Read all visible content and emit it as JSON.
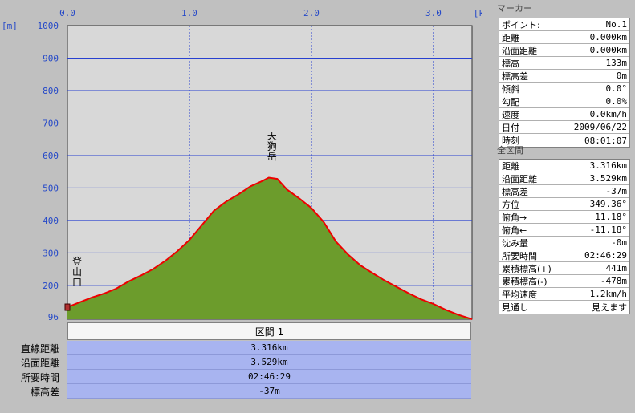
{
  "chart_data": {
    "type": "area",
    "x_unit": "[km]",
    "y_unit": "[m]",
    "xlim": [
      0,
      3.316
    ],
    "ylim": [
      96,
      1000
    ],
    "x_ticks": [
      "0.0",
      "1.0",
      "2.0",
      "3.0"
    ],
    "y_ticks": [
      "1000",
      "900",
      "800",
      "700",
      "600",
      "500",
      "400",
      "300",
      "200",
      "96"
    ],
    "x": [
      0.0,
      0.1,
      0.2,
      0.3,
      0.4,
      0.5,
      0.6,
      0.7,
      0.8,
      0.9,
      1.0,
      1.1,
      1.2,
      1.3,
      1.4,
      1.5,
      1.6,
      1.65,
      1.72,
      1.8,
      1.9,
      2.0,
      2.1,
      2.2,
      2.3,
      2.4,
      2.5,
      2.6,
      2.7,
      2.8,
      2.9,
      3.0,
      3.1,
      3.2,
      3.316
    ],
    "y": [
      133,
      148,
      163,
      175,
      190,
      212,
      230,
      250,
      275,
      305,
      340,
      385,
      430,
      458,
      480,
      505,
      522,
      532,
      528,
      495,
      468,
      438,
      395,
      335,
      295,
      262,
      238,
      215,
      195,
      175,
      157,
      143,
      125,
      110,
      96
    ],
    "annotations": [
      {
        "label": "天狗岳",
        "x": 1.65,
        "y": 532
      },
      {
        "label": "登山口",
        "x": 0.0,
        "y": 133
      }
    ],
    "fill_color": "#6c9c2c",
    "line_color": "#ee0000",
    "grid_color": "#2840d0",
    "bg_color": "#d8d8d8",
    "axis_label_color": "#2448c8"
  },
  "interval": {
    "header": "区間 1",
    "rows": [
      {
        "label": "直線距離",
        "value": "3.316km"
      },
      {
        "label": "沿面距離",
        "value": "3.529km"
      },
      {
        "label": "所要時間",
        "value": "02:46:29"
      },
      {
        "label": "標高差",
        "value": "-37m"
      }
    ]
  },
  "marker_panel": {
    "title": "マーカー",
    "rows": [
      {
        "label": "ポイント:",
        "value": "No.1"
      },
      {
        "label": "距離",
        "value": "0.000km"
      },
      {
        "label": "沿面距離",
        "value": "0.000km"
      },
      {
        "label": "標高",
        "value": "133m"
      },
      {
        "label": "標高差",
        "value": "0m"
      },
      {
        "label": "傾斜",
        "value": "0.0°"
      },
      {
        "label": "勾配",
        "value": "0.0%"
      },
      {
        "label": "速度",
        "value": "0.0km/h"
      },
      {
        "label": "日付",
        "value": "2009/06/22"
      },
      {
        "label": "時刻",
        "value": "08:01:07"
      }
    ]
  },
  "total_panel": {
    "title": "全区間",
    "rows": [
      {
        "label": "距離",
        "value": "3.316km"
      },
      {
        "label": "沿面距離",
        "value": "3.529km"
      },
      {
        "label": "標高差",
        "value": "-37m"
      },
      {
        "label": "方位",
        "value": "349.36°"
      },
      {
        "label": "俯角→",
        "value": "11.18°"
      },
      {
        "label": "俯角←",
        "value": "-11.18°"
      },
      {
        "label": "沈み量",
        "value": "-0m"
      },
      {
        "label": "所要時間",
        "value": "02:46:29"
      },
      {
        "label": "累積標高(+)",
        "value": "441m"
      },
      {
        "label": "累積標高(-)",
        "value": "-478m"
      },
      {
        "label": "平均速度",
        "value": "1.2km/h"
      },
      {
        "label": "見通し",
        "value": "見えます"
      }
    ]
  }
}
